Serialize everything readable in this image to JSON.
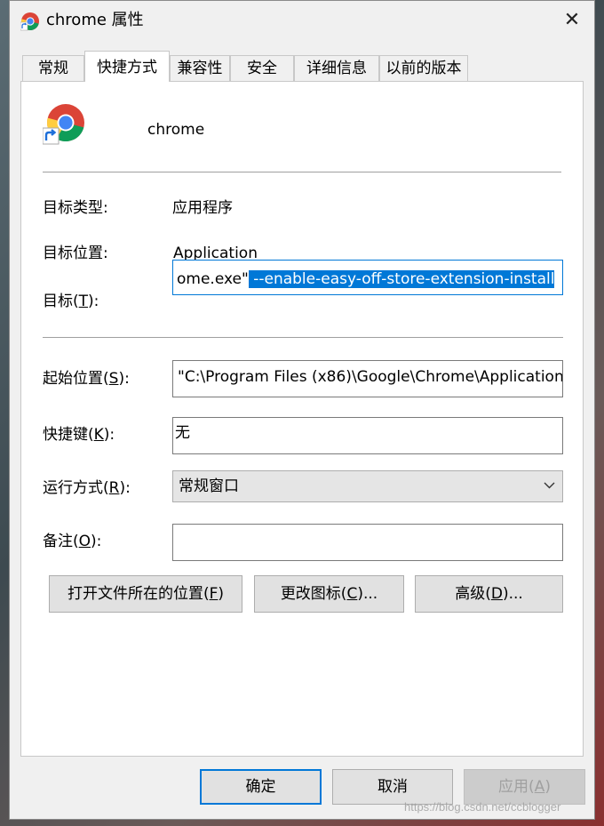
{
  "window": {
    "title": "chrome 属性",
    "close_glyph": "✕",
    "icon": "chrome-icon"
  },
  "tabs": [
    {
      "label": "常规"
    },
    {
      "label": "快捷方式",
      "active": true
    },
    {
      "label": "兼容性"
    },
    {
      "label": "安全"
    },
    {
      "label": "详细信息"
    },
    {
      "label": "以前的版本"
    }
  ],
  "shortcut": {
    "name": "chrome",
    "target_type_label": "目标类型:",
    "target_type_value": "应用程序",
    "target_location_label": "目标位置:",
    "target_location_value": "Application",
    "target_label_pre": "目标(",
    "target_label_key": "T",
    "target_label_post": "):",
    "target_value_plain": "ome.exe\"",
    "target_value_selected": " --enable-easy-off-store-extension-install",
    "start_in_label_pre": "起始位置(",
    "start_in_label_key": "S",
    "start_in_label_post": "):",
    "start_in_value": "\"C:\\Program Files (x86)\\Google\\Chrome\\Application",
    "shortcut_key_label_pre": "快捷键(",
    "shortcut_key_label_key": "K",
    "shortcut_key_label_post": "):",
    "shortcut_key_value": "无",
    "run_label_pre": "运行方式(",
    "run_label_key": "R",
    "run_label_post": "):",
    "run_value": "常规窗口",
    "comment_label_pre": "备注(",
    "comment_label_key": "O",
    "comment_label_post": "):",
    "comment_value": "",
    "open_location_pre": "打开文件所在的位置(",
    "open_location_key": "F",
    "open_location_post": ")",
    "change_icon_pre": "更改图标(",
    "change_icon_key": "C",
    "change_icon_post": ")...",
    "advanced_pre": "高级(",
    "advanced_key": "D",
    "advanced_post": ")..."
  },
  "footer": {
    "ok_label": "确定",
    "cancel_label": "取消",
    "apply_pre": "应用(",
    "apply_key": "A",
    "apply_post": ")"
  },
  "watermark": "https://blog.csdn.net/ccblogger",
  "colors": {
    "selection": "#0078d7",
    "dialog_bg": "#f0f0f0",
    "panel_bg": "#ffffff"
  }
}
